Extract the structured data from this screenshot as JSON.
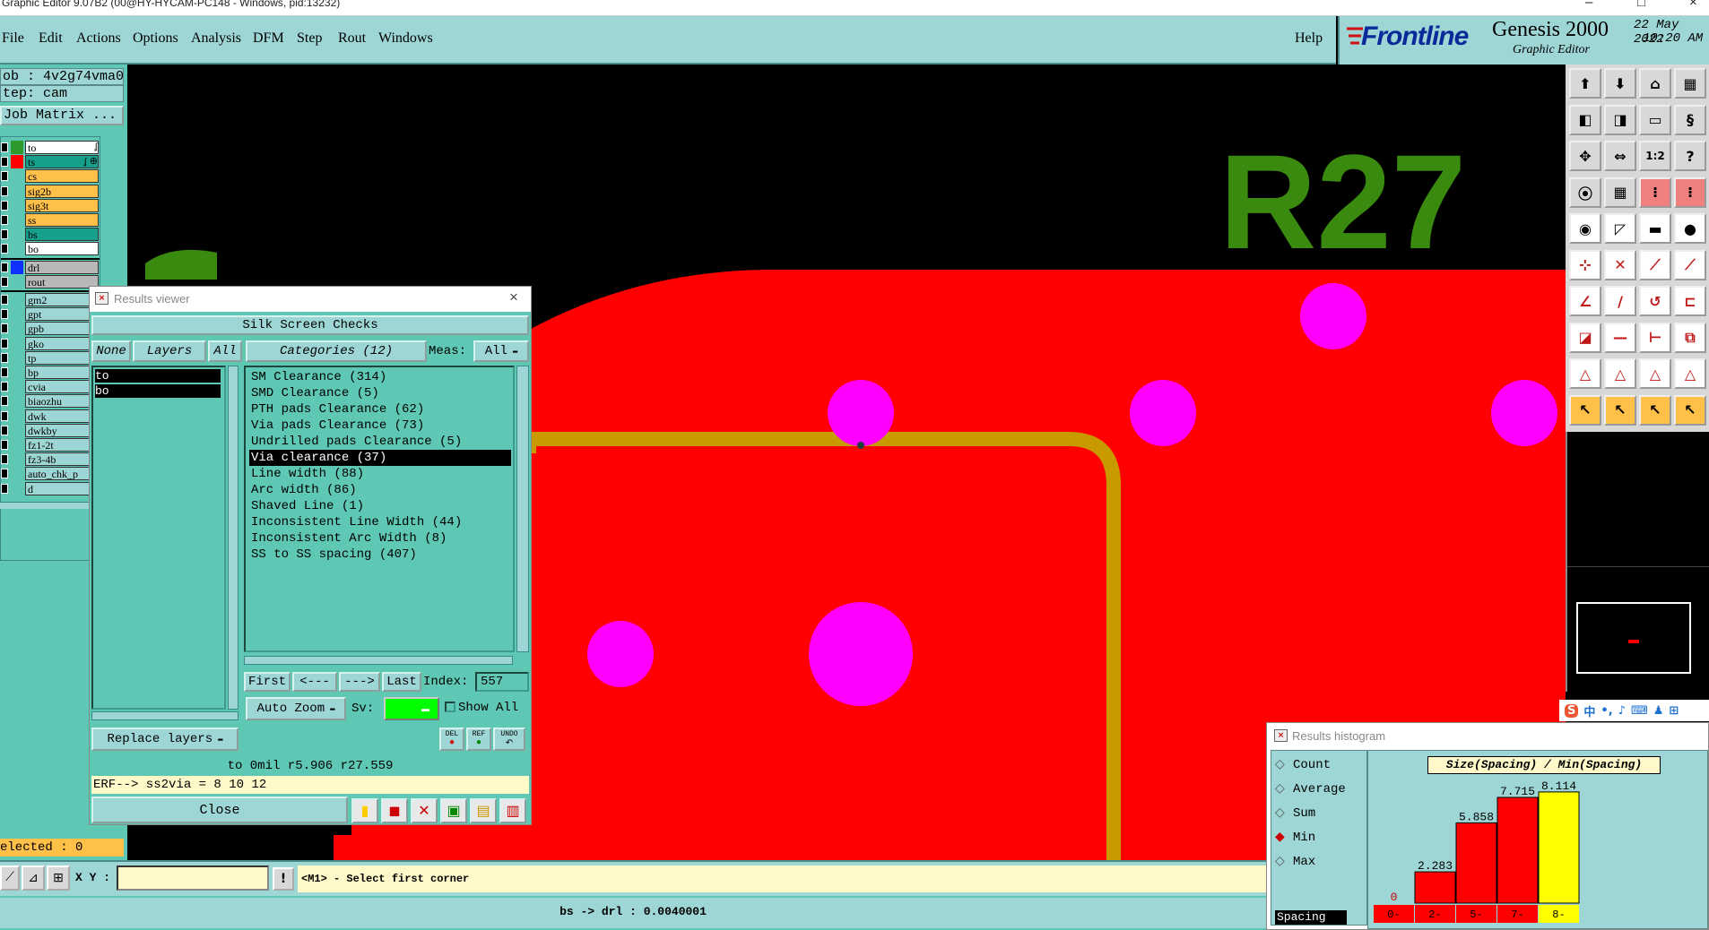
{
  "window": {
    "title": "Graphic Editor 9.07B2 (00@HY-HYCAM-PC148 - Windows, pid:13232)",
    "controls": [
      "–",
      "□",
      "×"
    ]
  },
  "menu": {
    "items": [
      "File",
      "Edit",
      "Actions",
      "Options",
      "Analysis",
      "DFM",
      "Step",
      "Rout",
      "Windows"
    ],
    "help": "Help"
  },
  "branding": {
    "logo": "Frontline",
    "product": "Genesis 2000",
    "subtitle": "Graphic Editor",
    "date": "22 May 2022",
    "time": "10:20 AM"
  },
  "left_panel": {
    "job": "ob : 4v2g74vma0",
    "step": "tep: cam",
    "job_matrix": "Job Matrix ...",
    "layers_board": [
      {
        "name": "to",
        "color": "#2e9a2e",
        "bg": "#ffffff",
        "tag": "ʆ"
      },
      {
        "name": "ts",
        "color": "#ff0000",
        "bg": "#16a08c",
        "tag": "ʆ ⊕"
      },
      {
        "name": "cs",
        "color": "",
        "bg": "#ffc04a",
        "tag": ""
      },
      {
        "name": "sig2b",
        "color": "",
        "bg": "#ffc04a",
        "tag": ""
      },
      {
        "name": "sig3t",
        "color": "",
        "bg": "#ffc04a",
        "tag": ""
      },
      {
        "name": "ss",
        "color": "",
        "bg": "#ffc04a",
        "tag": ""
      },
      {
        "name": "bs",
        "color": "",
        "bg": "#16a08c",
        "tag": ""
      },
      {
        "name": "bo",
        "color": "",
        "bg": "#ffffff",
        "tag": ""
      }
    ],
    "layers_drill": [
      {
        "name": "drl",
        "color": "#1030ff",
        "bg": "#b8b8b8"
      },
      {
        "name": "rout",
        "color": "",
        "bg": "#b8b8b8"
      }
    ],
    "layers_misc": [
      "gm2",
      "gpt",
      "gpb",
      "gko",
      "tp",
      "bp",
      "cvia",
      "biaozhu",
      "dwk",
      "dwkby",
      "fz1-2t",
      "fz3-4b",
      "auto_chk_p",
      "d"
    ],
    "selected": "elected : 0"
  },
  "canvas": {
    "label": "R27",
    "label_color": "#3a8a10",
    "copper_color": "#ff0000",
    "pad_color": "#ff00ff",
    "trace_color": "#c89a00"
  },
  "results_viewer": {
    "title": "Results viewer",
    "header": "Silk Screen Checks",
    "none_btn": "None",
    "layers_btn": "Layers",
    "all_btn": "All",
    "categories_btn": "Categories (12)",
    "meas_label": "Meas:",
    "meas_value": "All",
    "layers": [
      "to",
      "bo"
    ],
    "categories": [
      "SM Clearance (314)",
      "SMD Clearance (5)",
      "PTH pads Clearance (62)",
      "Via pads Clearance (73)",
      "Undrilled pads Clearance (5)",
      "Via clearance (37)",
      "Line width (88)",
      "Arc width (86)",
      "Shaved Line (1)",
      "Inconsistent Line Width (44)",
      "Inconsistent Arc Width (8)",
      "SS to SS spacing (407)"
    ],
    "selected_category": 5,
    "first_btn": "First",
    "prev_btn": "<---",
    "next_btn": "--->",
    "last_btn": "Last",
    "index_label": "Index:",
    "index_value": "557",
    "auto_zoom": "Auto Zoom",
    "sv_label": "Sv:",
    "show_all": "Show All",
    "replace_layers": "Replace layers",
    "del_btn": "DEL",
    "ref_btn": "REF",
    "undo_btn": "UNDO",
    "status": "to 0mil   r5.906   r27.559",
    "erf": "ERF--> ss2via = 8 10 12",
    "close_btn": "Close"
  },
  "bottom": {
    "xy_label": "X Y :",
    "xy_value": "",
    "prompt": "<M1> - Select first corner",
    "info": "bs -> drl : 0.0040001"
  },
  "histogram": {
    "title": "Results histogram",
    "options": [
      "Count",
      "Average",
      "Sum",
      "Min",
      "Max"
    ],
    "selected_option": 3,
    "spacing_label": "Spacing",
    "chart_title": "Size(Spacing) / Min(Spacing)",
    "chart_data": {
      "type": "bar",
      "title": "Size(Spacing) / Min(Spacing)",
      "categories": [
        "0-",
        "2-",
        "5-",
        "7-",
        "8-"
      ],
      "values": [
        0,
        2.283,
        5.858,
        7.715,
        8.114
      ],
      "value_labels": [
        "0",
        "2.283",
        "5.858",
        "7.715",
        "8.114"
      ],
      "colors": [
        "#ff0000",
        "#ff0000",
        "#ff0000",
        "#ff0000",
        "#ffff00"
      ],
      "ylim": [
        0,
        8.5
      ]
    }
  },
  "toolbar": {
    "icons": [
      "open-job-icon",
      "save-icon",
      "home-icon",
      "grid-icon",
      "step-left-icon",
      "step-right-icon",
      "window-icon",
      "snake-icon",
      "fit-icon",
      "zoom-icon",
      "scale-1-2-icon",
      "help-icon",
      "pad-icon",
      "mesh-icon",
      "layers-a-icon",
      "layers-b-icon",
      "camera-icon",
      "skew-icon",
      "ruler-icon",
      "circle-icon",
      "node-icon",
      "cross-icon",
      "link-a-icon",
      "link-b-icon",
      "angle-icon",
      "slash-icon",
      "arc-icon",
      "join-icon",
      "cutout-icon",
      "minus-icon",
      "measure-icon",
      "copy-icon",
      "triangle-a-icon",
      "triangle-b-icon",
      "triangle-c-icon",
      "triangle-d-icon",
      "pointer-a-icon",
      "pointer-b-icon",
      "pointer-c-icon",
      "pointer-d-icon"
    ],
    "scale_label": "1:2",
    "help_label": "?"
  }
}
